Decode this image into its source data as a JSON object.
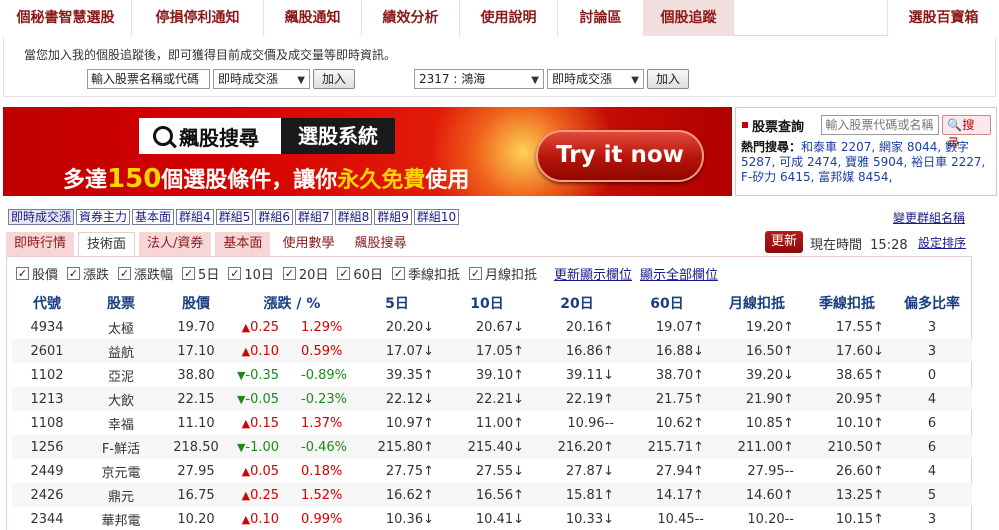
{
  "topnav": {
    "tabs": [
      {
        "label": "個秘書智慧選股",
        "w": 132,
        "active": false
      },
      {
        "label": "停損停利通知",
        "w": 132,
        "active": false
      },
      {
        "label": "飆股通知",
        "w": 98,
        "active": false
      },
      {
        "label": "績效分析",
        "w": 98,
        "active": false
      },
      {
        "label": "使用說明",
        "w": 98,
        "active": false
      },
      {
        "label": "討論區",
        "w": 86,
        "active": false
      },
      {
        "label": "個股追蹤",
        "w": 90,
        "active": true
      }
    ],
    "right_tab": "選股百寶箱"
  },
  "follow": {
    "description": "當您加入我的個股追蹤後，即可獲得目前成交價及成交量等即時資訊。",
    "input_label": "輸入股票名稱或代碼",
    "select_left": "即時成交漲",
    "add_left": "加入",
    "stock_select": "2317 : 鴻海",
    "select_right": "即時成交漲",
    "add_right": "加入"
  },
  "banner": {
    "logo_text": "飆股搜尋",
    "system_text": "選股系統",
    "slogan_pre": "多達",
    "slogan_num": "150",
    "slogan_mid": "個選股條件，讓你",
    "slogan_em": "永久免費",
    "slogan_post": "使用",
    "try_label": "Try it now"
  },
  "query": {
    "title": "股票查詢",
    "placeholder": "輸入股票代碼或名稱",
    "search_label": "搜尋",
    "hot_label": "熱門搜尋：",
    "hot_items": "和泰車 2207, 網家 8044, 數字 5287, 可成 2474, 寶雅 5904, 裕日車 2227, F-矽力 6415, 富邦媒 8454,"
  },
  "groups": {
    "tabs": [
      "即時成交漲",
      "資券主力",
      "基本面",
      "群組4",
      "群組5",
      "群組6",
      "群組7",
      "群組8",
      "群組9",
      "群組10"
    ],
    "rename": "變更群組名稱"
  },
  "views": {
    "tabs": [
      "即時行情",
      "技術面",
      "法人/資券",
      "基本面"
    ],
    "links": [
      "使用數學",
      "飆股搜尋"
    ],
    "refresh": "更新",
    "time_label": "現在時間",
    "time_value": "15:28",
    "sort": "設定排序"
  },
  "checks": {
    "items": [
      "股價",
      "漲跌",
      "漲跌幅",
      "5日",
      "10日",
      "20日",
      "60日",
      "季線扣抵",
      "月線扣抵"
    ],
    "link_update": "更新顯示欄位",
    "link_all": "顯示全部欄位"
  },
  "table": {
    "headers": [
      "代號",
      "股票",
      "股價",
      "漲跌 / %",
      "5日",
      "10日",
      "20日",
      "60日",
      "月線扣抵",
      "季線扣抵",
      "偏多比率"
    ],
    "rows": [
      {
        "code": "4934",
        "name": "太極",
        "price": "19.70",
        "dir": "up",
        "chg": "0.25",
        "pct": "1.29%",
        "d5": "20.20",
        "a5": "↓",
        "d10": "20.67",
        "a10": "↓",
        "d20": "20.16",
        "a20": "↑",
        "d60": "19.07",
        "a60": "↑",
        "m": "19.20",
        "am": "↑",
        "q": "17.55",
        "aq": "↑",
        "r": "3"
      },
      {
        "code": "2601",
        "name": "益航",
        "price": "17.10",
        "dir": "up",
        "chg": "0.10",
        "pct": "0.59%",
        "d5": "17.07",
        "a5": "↓",
        "d10": "17.05",
        "a10": "↑",
        "d20": "16.86",
        "a20": "↑",
        "d60": "16.88",
        "a60": "↓",
        "m": "16.50",
        "am": "↑",
        "q": "17.60",
        "aq": "↓",
        "r": "3"
      },
      {
        "code": "1102",
        "name": "亞泥",
        "price": "38.80",
        "dir": "dn",
        "chg": "-0.35",
        "pct": "-0.89%",
        "d5": "39.35",
        "a5": "↑",
        "d10": "39.10",
        "a10": "↑",
        "d20": "39.11",
        "a20": "↓",
        "d60": "38.70",
        "a60": "↑",
        "m": "39.20",
        "am": "↓",
        "q": "38.65",
        "aq": "↑",
        "r": "0"
      },
      {
        "code": "1213",
        "name": "大飲",
        "price": "22.15",
        "dir": "dn",
        "chg": "-0.05",
        "pct": "-0.23%",
        "d5": "22.12",
        "a5": "↓",
        "d10": "22.21",
        "a10": "↓",
        "d20": "22.19",
        "a20": "↑",
        "d60": "21.75",
        "a60": "↑",
        "m": "21.90",
        "am": "↑",
        "q": "20.95",
        "aq": "↑",
        "r": "4"
      },
      {
        "code": "1108",
        "name": "幸福",
        "price": "11.10",
        "dir": "up",
        "chg": "0.15",
        "pct": "1.37%",
        "d5": "10.97",
        "a5": "↑",
        "d10": "11.00",
        "a10": "↑",
        "d20": "10.96",
        "a20": "--",
        "d60": "10.62",
        "a60": "↑",
        "m": "10.85",
        "am": "↑",
        "q": "10.10",
        "aq": "↑",
        "r": "6"
      },
      {
        "code": "1256",
        "name": "F-鮮活",
        "price": "218.50",
        "dir": "dn",
        "chg": "-1.00",
        "pct": "-0.46%",
        "d5": "215.80",
        "a5": "↑",
        "d10": "215.40",
        "a10": "↓",
        "d20": "216.20",
        "a20": "↑",
        "d60": "215.71",
        "a60": "↑",
        "m": "211.00",
        "am": "↑",
        "q": "210.50",
        "aq": "↑",
        "r": "6"
      },
      {
        "code": "2449",
        "name": "京元電",
        "price": "27.95",
        "dir": "up",
        "chg": "0.05",
        "pct": "0.18%",
        "d5": "27.75",
        "a5": "↑",
        "d10": "27.55",
        "a10": "↓",
        "d20": "27.87",
        "a20": "↓",
        "d60": "27.94",
        "a60": "↑",
        "m": "27.95",
        "am": "--",
        "q": "26.60",
        "aq": "↑",
        "r": "4"
      },
      {
        "code": "2426",
        "name": "鼎元",
        "price": "16.75",
        "dir": "up",
        "chg": "0.25",
        "pct": "1.52%",
        "d5": "16.62",
        "a5": "↑",
        "d10": "16.56",
        "a10": "↑",
        "d20": "15.81",
        "a20": "↑",
        "d60": "14.17",
        "a60": "↑",
        "m": "14.60",
        "am": "↑",
        "q": "13.25",
        "aq": "↑",
        "r": "5"
      },
      {
        "code": "2344",
        "name": "華邦電",
        "price": "10.20",
        "dir": "up",
        "chg": "0.10",
        "pct": "0.99%",
        "d5": "10.36",
        "a5": "↓",
        "d10": "10.41",
        "a10": "↓",
        "d20": "10.33",
        "a20": "↓",
        "d60": "10.45",
        "a60": "--",
        "m": "10.20",
        "am": "--",
        "q": "10.15",
        "aq": "↑",
        "r": "3"
      }
    ]
  }
}
